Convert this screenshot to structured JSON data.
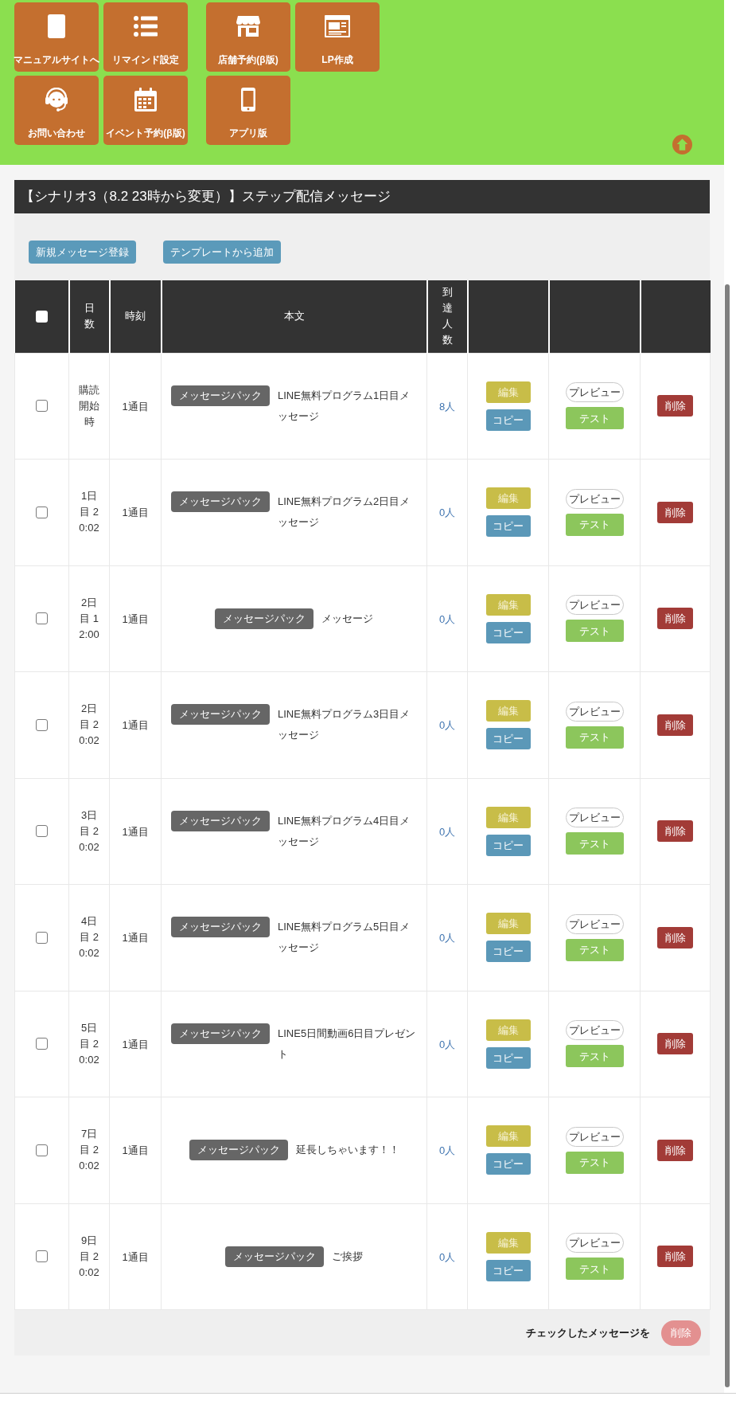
{
  "shortcut_groups": [
    {
      "tiles": [
        {
          "label": "マニュアルサイトへ"
        },
        {
          "label": "リマインド設定"
        },
        {
          "label": "お問い合わせ"
        },
        {
          "label": "イベント予約(β版)"
        }
      ]
    },
    {
      "tiles": [
        {
          "label": "店舗予約(β版)"
        },
        {
          "label": "LP作成"
        },
        {
          "label": "アプリ版"
        }
      ]
    }
  ],
  "panel": {
    "title": "【シナリオ3（8.2 23時から変更）】ステップ配信メッセージ",
    "toolbar_buttons": [
      "新規メッセージ登録",
      "テンプレートから追加"
    ],
    "table": {
      "select_all": {
        "checked": false
      },
      "columns": [
        "日数",
        "時刻",
        "本文",
        "到達人数"
      ],
      "rows": [
        {
          "checked": false,
          "day": "購読開始時",
          "order": "1通目",
          "tag": "メッセージパック",
          "text": "LINE無料プログラム1日目メッセージ",
          "reached": "8人",
          "buttons": {
            "edit": "編集",
            "copy": "コピー",
            "preview": "プレビュー",
            "test": "テスト",
            "delete": "削除"
          }
        },
        {
          "checked": false,
          "day": "1日目 20:02",
          "order": "1通目",
          "tag": "メッセージパック",
          "text": "LINE無料プログラム2日目メッセージ",
          "reached": "0人",
          "buttons": {
            "edit": "編集",
            "copy": "コピー",
            "preview": "プレビュー",
            "test": "テスト",
            "delete": "削除"
          }
        },
        {
          "checked": false,
          "day": "2日目 12:00",
          "order": "1通目",
          "tag": "メッセージパック",
          "text": "メッセージ",
          "reached": "0人",
          "buttons": {
            "edit": "編集",
            "copy": "コピー",
            "preview": "プレビュー",
            "test": "テスト",
            "delete": "削除"
          }
        },
        {
          "checked": false,
          "day": "2日目 20:02",
          "order": "1通目",
          "tag": "メッセージパック",
          "text": "LINE無料プログラム3日目メッセージ",
          "reached": "0人",
          "buttons": {
            "edit": "編集",
            "copy": "コピー",
            "preview": "プレビュー",
            "test": "テスト",
            "delete": "削除"
          }
        },
        {
          "checked": false,
          "day": "3日目 20:02",
          "order": "1通目",
          "tag": "メッセージパック",
          "text": "LINE無料プログラム4日目メッセージ",
          "reached": "0人",
          "buttons": {
            "edit": "編集",
            "copy": "コピー",
            "preview": "プレビュー",
            "test": "テスト",
            "delete": "削除"
          }
        },
        {
          "checked": false,
          "day": "4日目 20:02",
          "order": "1通目",
          "tag": "メッセージパック",
          "text": "LINE無料プログラム5日目メッセージ",
          "reached": "0人",
          "buttons": {
            "edit": "編集",
            "copy": "コピー",
            "preview": "プレビュー",
            "test": "テスト",
            "delete": "削除"
          }
        },
        {
          "checked": false,
          "day": "5日目 20:02",
          "order": "1通目",
          "tag": "メッセージパック",
          "text": "LINE5日間動画6日目プレゼント",
          "reached": "0人",
          "buttons": {
            "edit": "編集",
            "copy": "コピー",
            "preview": "プレビュー",
            "test": "テスト",
            "delete": "削除"
          }
        },
        {
          "checked": false,
          "day": "7日目 20:02",
          "order": "1通目",
          "tag": "メッセージパック",
          "text": "延長しちゃいます！！",
          "reached": "0人",
          "buttons": {
            "edit": "編集",
            "copy": "コピー",
            "preview": "プレビュー",
            "test": "テスト",
            "delete": "削除"
          }
        },
        {
          "checked": false,
          "day": "9日目 20:02",
          "order": "1通目",
          "tag": "メッセージパック",
          "text": "ご挨拶",
          "reached": "0人",
          "buttons": {
            "edit": "編集",
            "copy": "コピー",
            "preview": "プレビュー",
            "test": "テスト",
            "delete": "削除"
          }
        }
      ]
    },
    "footer": {
      "label": "チェックしたメッセージを",
      "delete_button": {
        "label": "削除",
        "disabled": true
      }
    }
  }
}
